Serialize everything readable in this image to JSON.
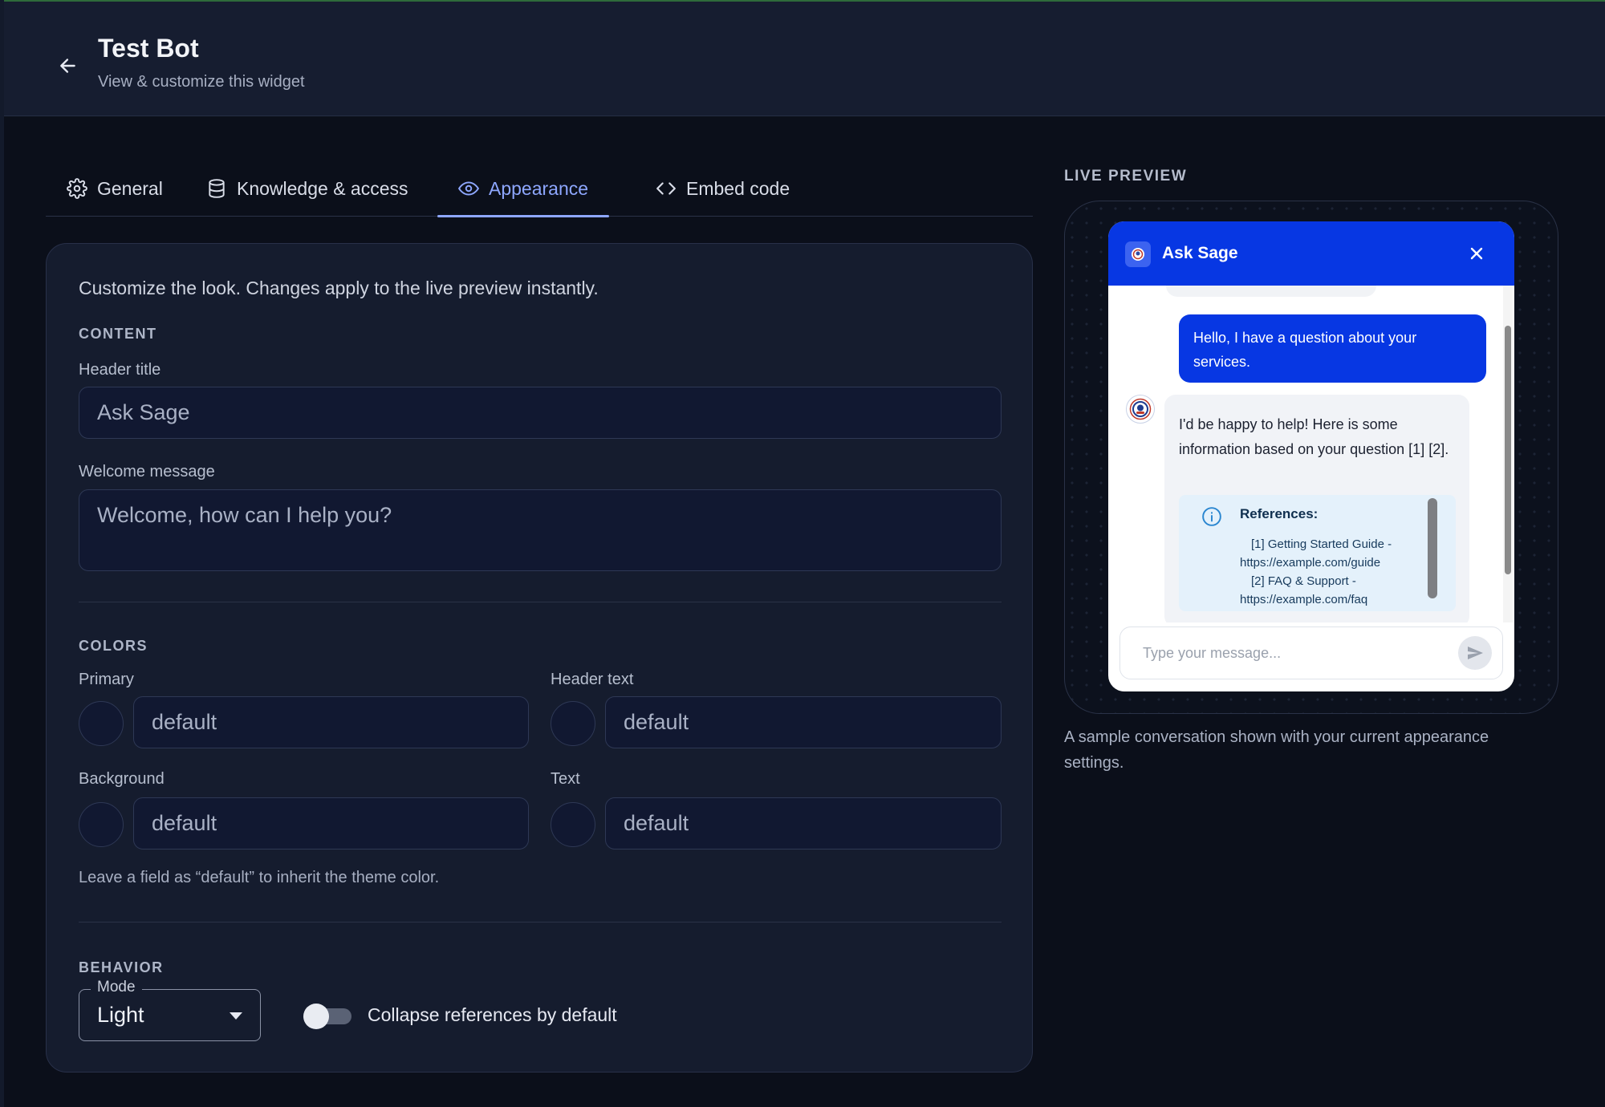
{
  "page": {
    "title": "Test Bot",
    "subtitle": "View & customize this widget"
  },
  "tabs": [
    {
      "label": "General",
      "icon": "gear-icon"
    },
    {
      "label": "Knowledge & access",
      "icon": "database-icon"
    },
    {
      "label": "Appearance",
      "icon": "eye-icon",
      "active": true
    },
    {
      "label": "Embed code",
      "icon": "code-icon"
    }
  ],
  "panel": {
    "intro": "Customize the look. Changes apply to the live preview instantly.",
    "content": {
      "section": "CONTENT",
      "header_title_label": "Header title",
      "header_title_value": "Ask Sage",
      "welcome_label": "Welcome message",
      "welcome_value": "Welcome, how can I help you?"
    },
    "colors": {
      "section": "COLORS",
      "primary_label": "Primary",
      "primary_value": "default",
      "header_text_label": "Header text",
      "header_text_value": "default",
      "background_label": "Background",
      "background_value": "default",
      "text_label": "Text",
      "text_value": "default",
      "hint": "Leave a field as “default” to inherit the theme color."
    },
    "behavior": {
      "section": "BEHAVIOR",
      "mode_label": "Mode",
      "mode_value": "Light",
      "collapse_label": "Collapse references by default",
      "collapse_on": false
    }
  },
  "preview": {
    "label": "LIVE PREVIEW",
    "widget_title": "Ask Sage",
    "user_message": "Hello, I have a question about your services.",
    "bot_message": "I'd be happy to help! Here is some information based on your question [1] [2].",
    "references_title": "References:",
    "references": [
      "[1] Getting Started Guide -",
      "https://example.com/guide",
      "[2] FAQ & Support -",
      "https://example.com/faq"
    ],
    "input_placeholder": "Type your message...",
    "caption": "A sample conversation shown with your current appearance settings.",
    "colors": {
      "primary": "#0737e3",
      "accent": "#8ea7ff"
    }
  }
}
